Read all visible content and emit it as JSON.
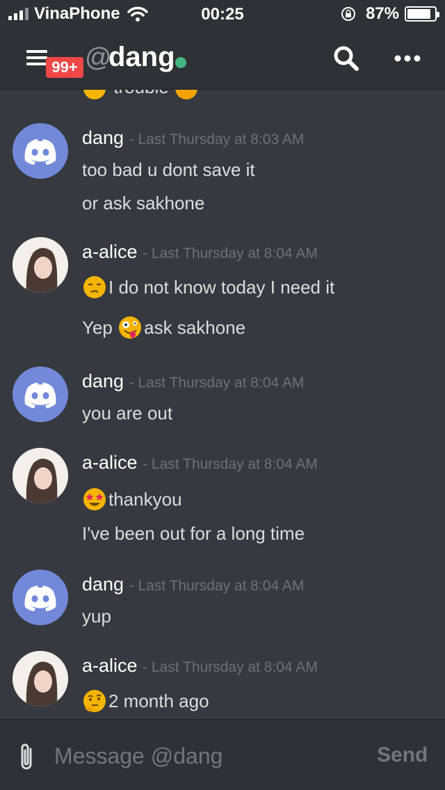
{
  "status_bar": {
    "carrier": "VinaPhone",
    "time": "00:25",
    "battery_percent": "87%",
    "battery_level": 0.87
  },
  "header": {
    "badge": "99+",
    "at_symbol": "@",
    "channel_name": "dang",
    "online_color": "#43b581"
  },
  "partial_message": "trouble",
  "messages": [
    {
      "author": "dang",
      "timestamp": "- Last Thursday at 8:03 AM",
      "avatar": "discord-logo",
      "lines": [
        "too bad u dont  save it",
        "or ask sakhone"
      ]
    },
    {
      "author": "a-alice",
      "timestamp": "- Last Thursday at 8:04 AM",
      "avatar": "user-photo",
      "lines": [
        "I do not know today I need it",
        "Yep ",
        "ask sakhone"
      ]
    },
    {
      "author": "dang",
      "timestamp": "- Last Thursday at 8:04 AM",
      "avatar": "discord-logo",
      "lines": [
        "you are out"
      ]
    },
    {
      "author": "a-alice",
      "timestamp": "- Last Thursday at 8:04 AM",
      "avatar": "user-photo",
      "lines": [
        "thankyou",
        "I've been out for a long time"
      ]
    },
    {
      "author": "dang",
      "timestamp": "- Last Thursday at 8:04 AM",
      "avatar": "discord-logo",
      "lines": [
        "yup"
      ]
    },
    {
      "author": "a-alice",
      "timestamp": "- Last Thursday at 8:04 AM",
      "avatar": "user-photo",
      "lines": [
        "2 month ago"
      ]
    }
  ],
  "composer": {
    "placeholder": "Message @dang",
    "send_label": "Send"
  },
  "colors": {
    "background": "#36393f",
    "header": "#2f3136",
    "blurple": "#7289da",
    "badge": "#f04747"
  }
}
